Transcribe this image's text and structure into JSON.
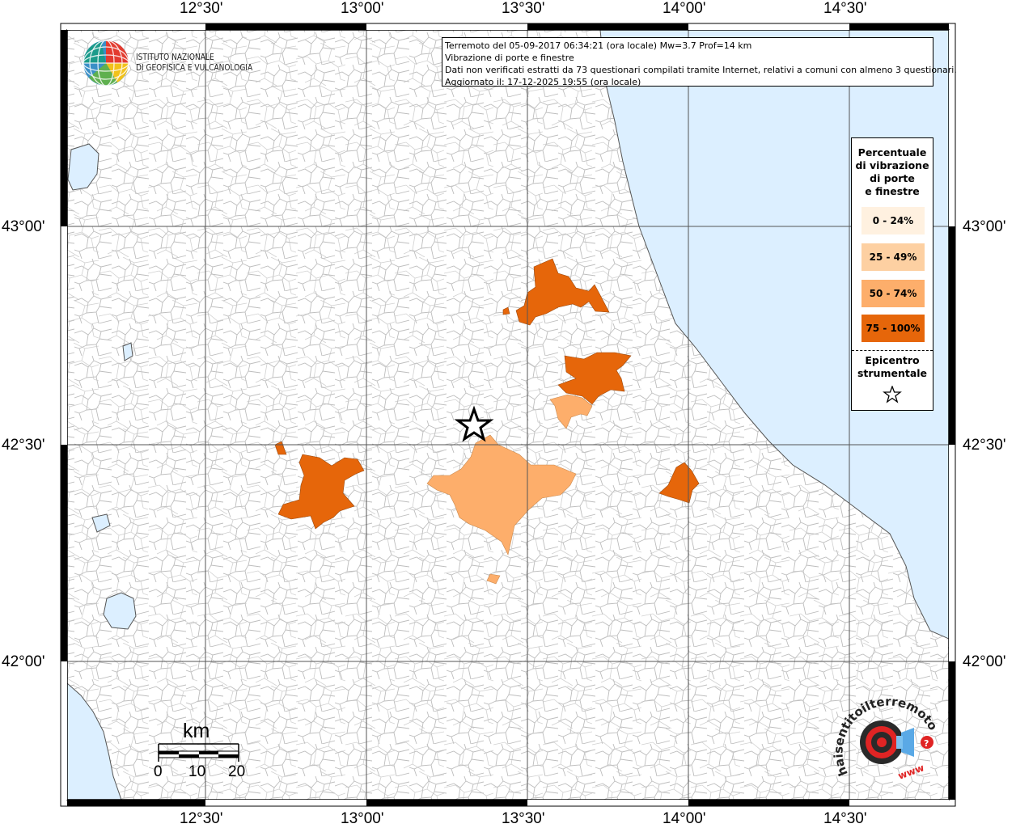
{
  "map": {
    "lon_labels": [
      "12°30'",
      "13°00'",
      "13°30'",
      "14°00'",
      "14°30'"
    ],
    "lat_labels": [
      "43°00'",
      "42°30'",
      "42°00'"
    ],
    "colors": {
      "sea": "#dcefff",
      "class_0_24": "#fff1e0",
      "class_25_49": "#fdd0a2",
      "class_50_74": "#fdae6b",
      "class_75_100": "#e6660a",
      "municipal_border": "#b8b8b8"
    }
  },
  "info": {
    "line1": "Terremoto del 05-09-2017 06:34:21 (ora locale) Mw=3.7 Prof=14 km",
    "line2": "Vibrazione di porte e finestre",
    "line3": "Dati non verificati estratti da 73 questionari compilati tramite Internet, relativi a comuni con almeno 3 questionari.",
    "line4": "Aggiornato il: 17-12-2025 19:55 (ora locale)"
  },
  "institute": {
    "line1": "ISTITUTO NAZIONALE",
    "line2": "DI GEOFISICA E VULCANOLOGIA"
  },
  "legend": {
    "title_lines": [
      "Percentuale",
      "di vibrazione",
      "di porte",
      "e finestre"
    ],
    "classes": [
      {
        "label": "0 - 24%",
        "color": "#fff1e0"
      },
      {
        "label": "25 - 49%",
        "color": "#fdd0a2"
      },
      {
        "label": "50 - 74%",
        "color": "#fdae6b"
      },
      {
        "label": "75 - 100%",
        "color": "#e6660a"
      }
    ],
    "epicenter_lines": [
      "Epicentro",
      "strumentale"
    ],
    "epicenter_icon": "star-icon"
  },
  "scale": {
    "unit": "km",
    "ticks": [
      "0",
      "10",
      "20"
    ]
  },
  "watermark": {
    "icon": "haisentito-logo-icon",
    "text": "haisentitoilterremoto.it",
    "prefix": "www"
  }
}
